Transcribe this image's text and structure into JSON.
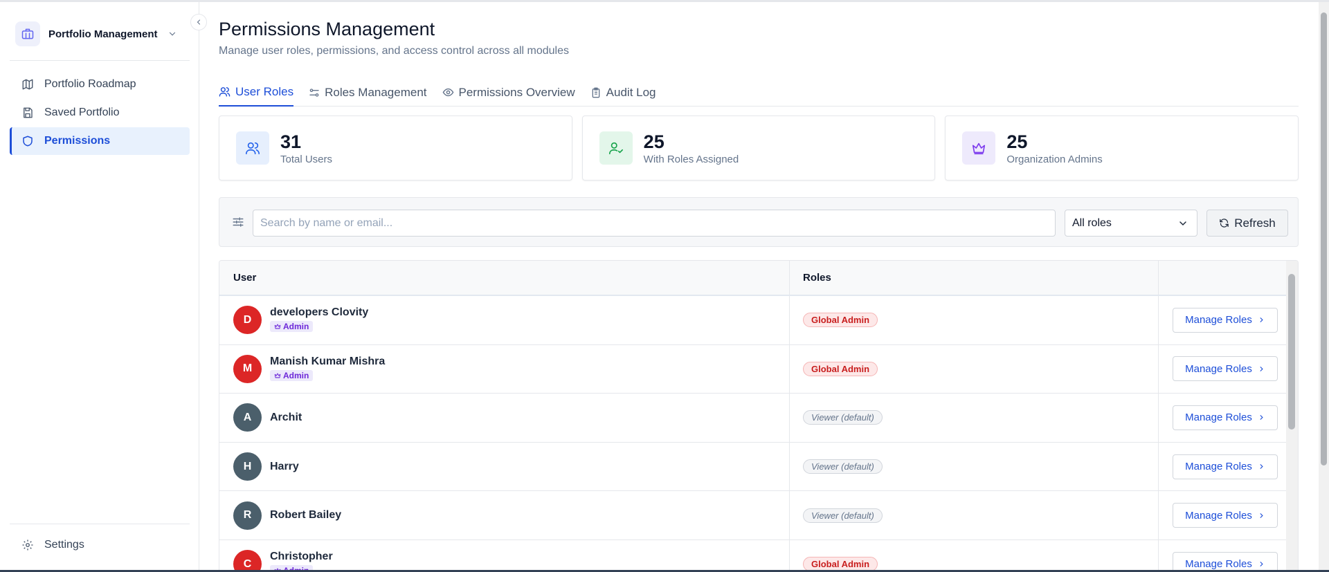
{
  "sidebar": {
    "workspace_name": "Portfolio Management",
    "items": [
      {
        "label": "Portfolio Roadmap",
        "icon": "map-icon"
      },
      {
        "label": "Saved Portfolio",
        "icon": "save-icon"
      },
      {
        "label": "Permissions",
        "icon": "shield-icon",
        "active": true
      }
    ],
    "settings_label": "Settings"
  },
  "header": {
    "title": "Permissions Management",
    "subtitle": "Manage user roles, permissions, and access control across all modules"
  },
  "tabs": [
    {
      "label": "User Roles",
      "icon": "users-icon",
      "active": true
    },
    {
      "label": "Roles Management",
      "icon": "sliders-icon"
    },
    {
      "label": "Permissions Overview",
      "icon": "eye-icon"
    },
    {
      "label": "Audit Log",
      "icon": "clipboard-icon"
    }
  ],
  "stats": [
    {
      "value": "31",
      "label": "Total Users",
      "icon": "users-icon",
      "color": "#2563eb",
      "bg": "#e6effd"
    },
    {
      "value": "25",
      "label": "With Roles Assigned",
      "icon": "user-check-icon",
      "color": "#16a34a",
      "bg": "#e3f6ea"
    },
    {
      "value": "25",
      "label": "Organization Admins",
      "icon": "crown-icon",
      "color": "#7c3aed",
      "bg": "#eeeafc"
    }
  ],
  "filters": {
    "search_placeholder": "Search by name or email...",
    "role_select": "All roles",
    "refresh_label": "Refresh"
  },
  "table": {
    "columns": [
      "User",
      "Roles",
      ""
    ],
    "manage_label": "Manage Roles",
    "admin_badge_label": "Admin",
    "rows": [
      {
        "initial": "D",
        "name": "developers Clovity",
        "is_admin": true,
        "role": "Global Admin",
        "role_type": "admin",
        "avatar_color": "#dc2626"
      },
      {
        "initial": "M",
        "name": "Manish Kumar Mishra",
        "is_admin": true,
        "role": "Global Admin",
        "role_type": "admin",
        "avatar_color": "#dc2626"
      },
      {
        "initial": "A",
        "name": "Archit",
        "is_admin": false,
        "role": "Viewer (default)",
        "role_type": "viewer",
        "avatar_color": "#4b5f6b"
      },
      {
        "initial": "H",
        "name": "Harry",
        "is_admin": false,
        "role": "Viewer (default)",
        "role_type": "viewer",
        "avatar_color": "#4b5f6b"
      },
      {
        "initial": "R",
        "name": "Robert Bailey",
        "is_admin": false,
        "role": "Viewer (default)",
        "role_type": "viewer",
        "avatar_color": "#4b5f6b"
      },
      {
        "initial": "C",
        "name": "Christopher",
        "is_admin": true,
        "role": "Global Admin",
        "role_type": "admin",
        "avatar_color": "#dc2626"
      }
    ]
  }
}
